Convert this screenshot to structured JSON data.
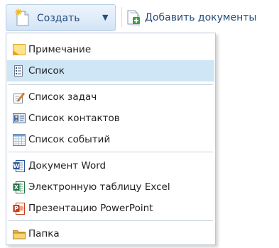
{
  "toolbar": {
    "create_label": "Создать",
    "create_caret": "▼",
    "add_documents_label": "Добавить документы"
  },
  "menu": {
    "items": [
      {
        "label": "Примечание",
        "icon": "note-icon"
      },
      {
        "label": "Список",
        "icon": "list-icon",
        "selected": true
      },
      {
        "label": "Список задач",
        "icon": "task-list-icon"
      },
      {
        "label": "Список контактов",
        "icon": "contacts-list-icon"
      },
      {
        "label": "Список событий",
        "icon": "events-list-icon"
      },
      {
        "label": "Документ Word",
        "icon": "word-document-icon"
      },
      {
        "label": "Электронную таблицу Excel",
        "icon": "excel-spreadsheet-icon"
      },
      {
        "label": "Презентацию PowerPoint",
        "icon": "powerpoint-presentation-icon"
      },
      {
        "label": "Папка",
        "icon": "folder-icon"
      }
    ]
  },
  "colors": {
    "selected_background": "#cfe6f6",
    "toolbar_text": "#234a7a",
    "menu_border": "#b9c9da"
  }
}
